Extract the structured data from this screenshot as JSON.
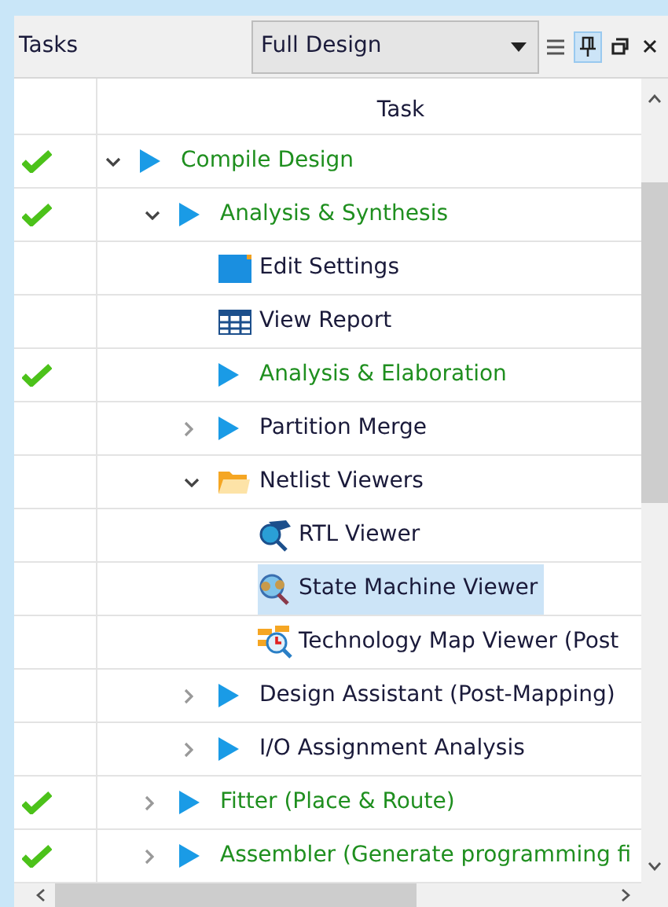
{
  "panel": {
    "title": "Tasks",
    "flow": "Full Design"
  },
  "table": {
    "column_2": "Task"
  },
  "tasks": [
    {
      "label": "Compile Design",
      "kind": "run",
      "done": true,
      "expanded": true,
      "selected": false,
      "children": [
        {
          "label": "Analysis & Synthesis",
          "kind": "run",
          "done": true,
          "expanded": true,
          "selected": false,
          "children": [
            {
              "label": "Edit Settings",
              "kind": "settings",
              "done": false,
              "selected": false
            },
            {
              "label": "View Report",
              "kind": "report",
              "done": false,
              "selected": false
            },
            {
              "label": "Analysis & Elaboration",
              "kind": "run",
              "done": true,
              "selected": false
            },
            {
              "label": "Partition Merge",
              "kind": "run",
              "done": false,
              "expanded": false,
              "selected": false
            },
            {
              "label": "Netlist Viewers",
              "kind": "folder",
              "done": false,
              "expanded": true,
              "selected": false,
              "children": [
                {
                  "label": "RTL Viewer",
                  "kind": "rtl",
                  "done": false,
                  "selected": false
                },
                {
                  "label": "State Machine Viewer",
                  "kind": "fsm",
                  "done": false,
                  "selected": true
                },
                {
                  "label": "Technology Map Viewer (Post",
                  "kind": "techmap",
                  "done": false,
                  "selected": false
                }
              ]
            },
            {
              "label": "Design Assistant (Post-Mapping)",
              "kind": "run",
              "done": false,
              "expanded": false,
              "selected": false
            },
            {
              "label": "I/O Assignment Analysis",
              "kind": "run",
              "done": false,
              "expanded": false,
              "selected": false
            }
          ]
        },
        {
          "label": "Fitter (Place & Route)",
          "kind": "run",
          "done": true,
          "expanded": false,
          "selected": false
        },
        {
          "label": "Assembler (Generate programming fi",
          "kind": "run",
          "done": true,
          "expanded": false,
          "selected": false
        }
      ]
    }
  ]
}
